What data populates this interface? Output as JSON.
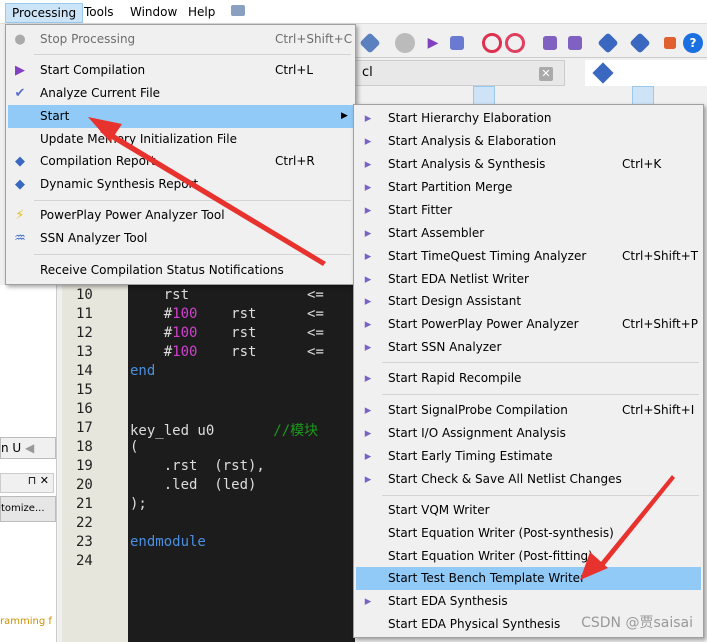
{
  "menubar": {
    "items": [
      "Processing",
      "Tools",
      "Window",
      "Help"
    ],
    "active": "Processing"
  },
  "tab": {
    "title": "cl",
    "close": "✕",
    "icon": "abc"
  },
  "left_panel": {
    "tab_label": "n U",
    "customize_label": "tomize...",
    "message": "ramming f"
  },
  "editor": {
    "lines": [
      "10",
      "11",
      "12",
      "13",
      "14",
      "15",
      "16",
      "17",
      "18",
      "19",
      "20",
      "21",
      "22",
      "23",
      "24"
    ]
  },
  "processing_menu": [
    {
      "label": "Stop Processing",
      "shortcut": "Ctrl+Shift+C",
      "icon": "stop-icon",
      "disabled": true
    },
    {
      "label": "Start Compilation",
      "shortcut": "Ctrl+L",
      "icon": "play-icon"
    },
    {
      "label": "Analyze Current File",
      "shortcut": "",
      "icon": "analyze-icon"
    },
    {
      "label": "Start",
      "shortcut": "",
      "submenu": true,
      "highlighted": true
    },
    {
      "label": "Update Memory Initialization File",
      "shortcut": ""
    },
    {
      "label": "Compilation Report",
      "shortcut": "Ctrl+R",
      "icon": "report-icon"
    },
    {
      "label": "Dynamic Synthesis Report",
      "shortcut": "",
      "icon": "report-icon"
    },
    {
      "label": "PowerPlay Power Analyzer Tool",
      "shortcut": "",
      "icon": "lightning-icon"
    },
    {
      "label": "SSN Analyzer Tool",
      "shortcut": "",
      "icon": "ssn-icon"
    },
    {
      "label": "Receive Compilation Status Notifications",
      "shortcut": ""
    }
  ],
  "start_submenu": [
    {
      "label": "Start Hierarchy Elaboration",
      "shortcut": ""
    },
    {
      "label": "Start Analysis & Elaboration",
      "shortcut": ""
    },
    {
      "label": "Start Analysis & Synthesis",
      "shortcut": "Ctrl+K"
    },
    {
      "label": "Start Partition Merge",
      "shortcut": ""
    },
    {
      "label": "Start Fitter",
      "shortcut": ""
    },
    {
      "label": "Start Assembler",
      "shortcut": ""
    },
    {
      "label": "Start TimeQuest Timing Analyzer",
      "shortcut": "Ctrl+Shift+T"
    },
    {
      "label": "Start EDA Netlist Writer",
      "shortcut": ""
    },
    {
      "label": "Start Design Assistant",
      "shortcut": ""
    },
    {
      "label": "Start PowerPlay Power Analyzer",
      "shortcut": "Ctrl+Shift+P"
    },
    {
      "label": "Start SSN Analyzer",
      "shortcut": ""
    },
    {
      "label": "Start Rapid Recompile",
      "shortcut": ""
    },
    {
      "label": "Start SignalProbe Compilation",
      "shortcut": "Ctrl+Shift+I"
    },
    {
      "label": "Start I/O Assignment Analysis",
      "shortcut": ""
    },
    {
      "label": "Start Early Timing Estimate",
      "shortcut": ""
    },
    {
      "label": "Start Check & Save All Netlist Changes",
      "shortcut": ""
    },
    {
      "label": "Start VQM Writer",
      "shortcut": ""
    },
    {
      "label": "Start Equation Writer (Post-synthesis)",
      "shortcut": ""
    },
    {
      "label": "Start Equation Writer (Post-fitting)",
      "shortcut": ""
    },
    {
      "label": "Start Test Bench Template Writer",
      "shortcut": "",
      "highlighted": true
    },
    {
      "label": "Start EDA Synthesis",
      "shortcut": ""
    },
    {
      "label": "Start EDA Physical Synthesis",
      "shortcut": ""
    }
  ],
  "watermark": "CSDN @贾saisai",
  "colors": {
    "highlight": "#91c9f7",
    "arrow": "#e8322e",
    "editor_bg": "#1c1c1c",
    "keyword": "#4a8fe0",
    "number": "#d040d0",
    "comment": "#1a9a1a"
  }
}
